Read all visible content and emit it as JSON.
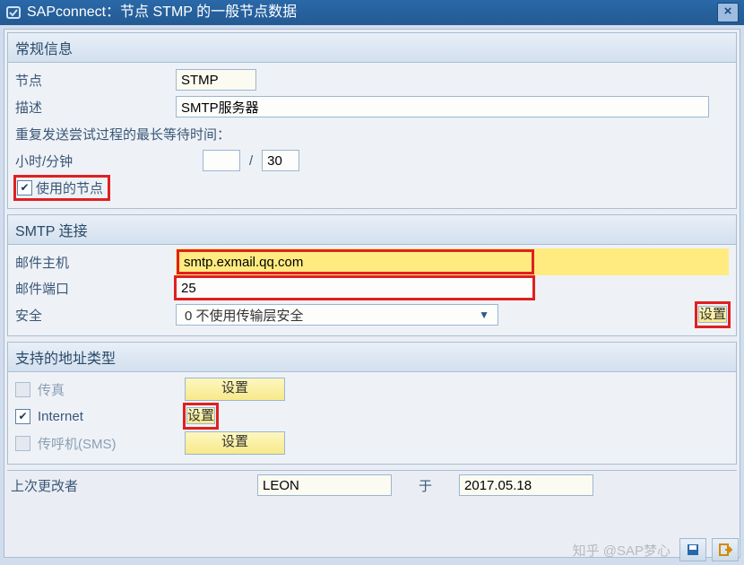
{
  "titlebar": {
    "icon_label": "sap-icon",
    "title": "SAPconnect：节点 STMP 的一般节点数据",
    "close_label": "×"
  },
  "general": {
    "head": "常规信息",
    "node_lbl": "节点",
    "node_val": "STMP",
    "desc_lbl": "描述",
    "desc_val": "SMTP服务器",
    "retry_lbl": "重复发送尝试过程的最长等待时间：",
    "hhmm_lbl": "小时/分钟",
    "hours": "",
    "minutes": "30",
    "used_node_lbl": "使用的节点"
  },
  "smtp": {
    "head": "SMTP 连接",
    "host_lbl": "邮件主机",
    "host_val": "smtp.exmail.qq.com",
    "port_lbl": "邮件端口",
    "port_val": "25",
    "sec_lbl": "安全",
    "sec_val": "0 不使用传输层安全",
    "settings_btn": "设置"
  },
  "addr": {
    "head": "支持的地址类型",
    "fax_lbl": "传真",
    "fax_btn": "设置",
    "internet_lbl": "Internet",
    "internet_btn": "设置",
    "sms_lbl": "传呼机(SMS)",
    "sms_btn": "设置"
  },
  "footer": {
    "last_changed_lbl": "上次更改者",
    "user": "LEON",
    "on_lbl": "于",
    "date": "2017.05.18"
  },
  "watermark": "知乎 @SAP梦心"
}
